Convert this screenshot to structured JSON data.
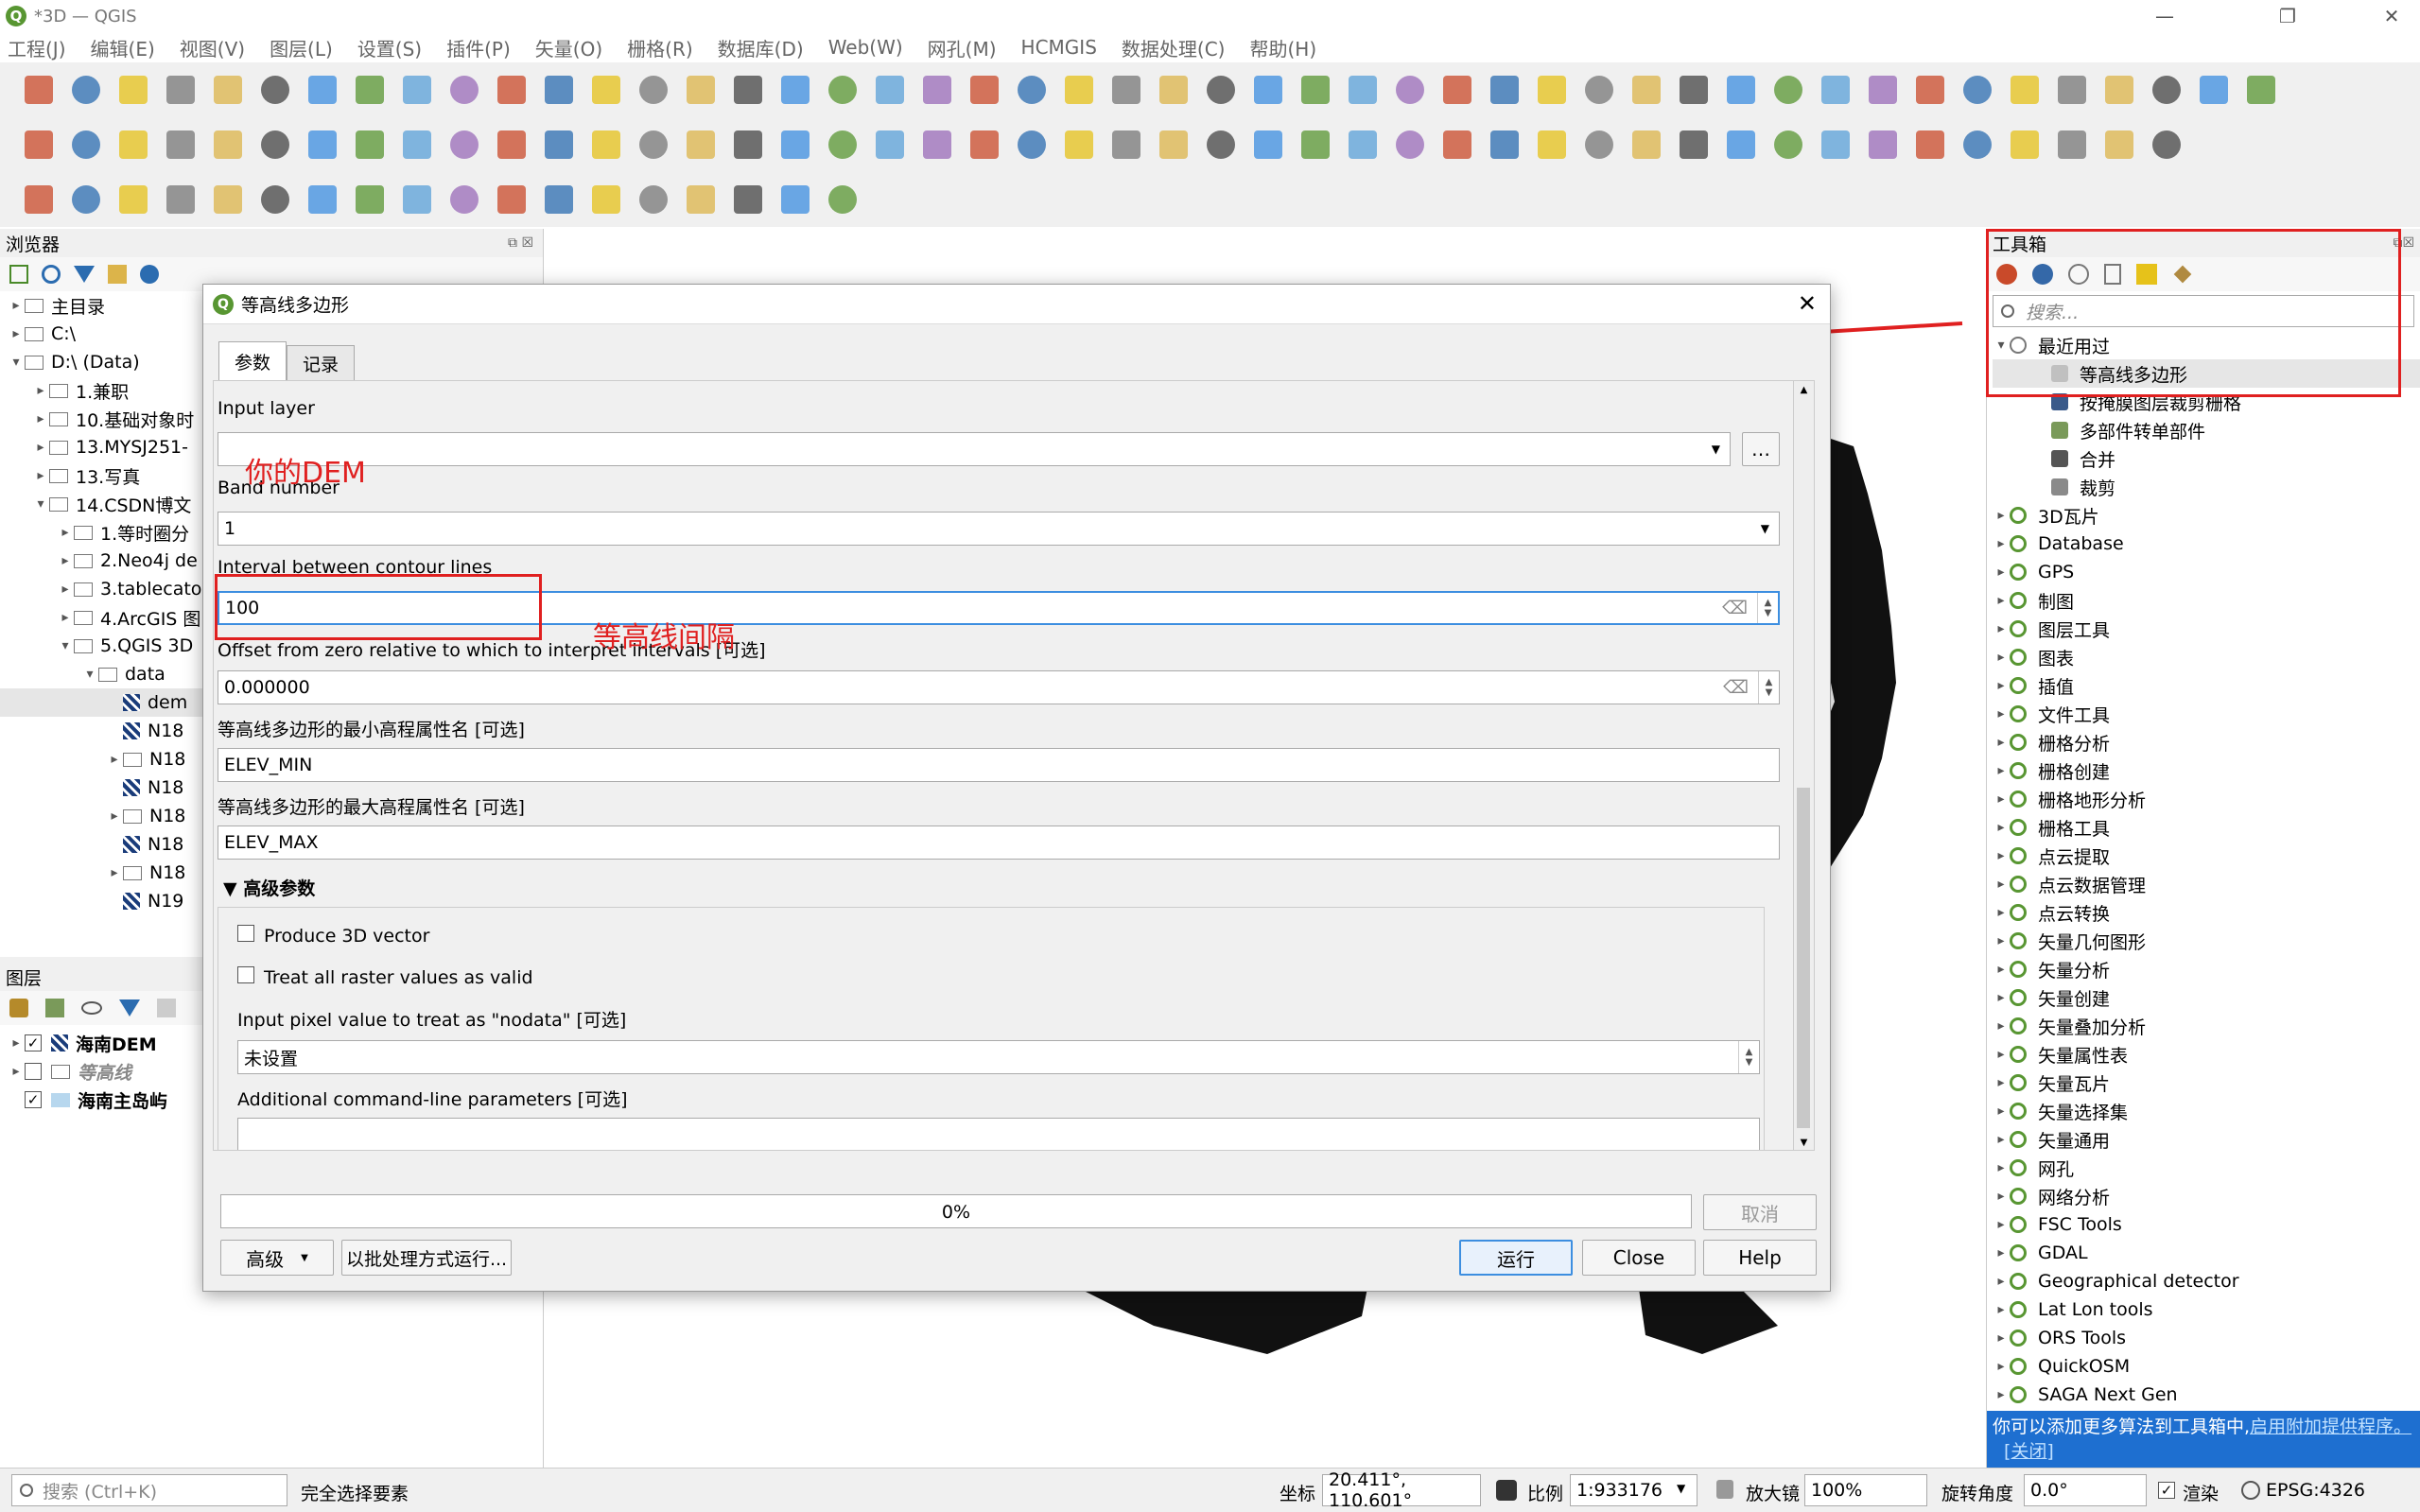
{
  "window": {
    "title": "*3D — QGIS"
  },
  "menu": [
    "工程(J)",
    "编辑(E)",
    "视图(V)",
    "图层(L)",
    "设置(S)",
    "插件(P)",
    "矢量(O)",
    "栅格(R)",
    "数据库(D)",
    "Web(W)",
    "网孔(M)",
    "HCMGIS",
    "数据处理(C)",
    "帮助(H)"
  ],
  "browser": {
    "title": "浏览器",
    "items": [
      {
        "label": "主目录",
        "depth": 0,
        "arrow": "▸",
        "icon": "folder"
      },
      {
        "label": "C:\\",
        "depth": 0,
        "arrow": "▸",
        "icon": "folder"
      },
      {
        "label": "D:\\ (Data)",
        "depth": 0,
        "arrow": "▾",
        "icon": "folder"
      },
      {
        "label": "1.兼职",
        "depth": 1,
        "arrow": "▸",
        "icon": "folder"
      },
      {
        "label": "10.基础对象时",
        "depth": 1,
        "arrow": "▸",
        "icon": "folder"
      },
      {
        "label": "13.MYSJ251-",
        "depth": 1,
        "arrow": "▸",
        "icon": "folder"
      },
      {
        "label": "13.写真",
        "depth": 1,
        "arrow": "▸",
        "icon": "folder"
      },
      {
        "label": "14.CSDN博文",
        "depth": 1,
        "arrow": "▾",
        "icon": "folder"
      },
      {
        "label": "1.等时圈分",
        "depth": 2,
        "arrow": "▸",
        "icon": "folder"
      },
      {
        "label": "2.Neo4j de",
        "depth": 2,
        "arrow": "▸",
        "icon": "folder"
      },
      {
        "label": "3.tablecato",
        "depth": 2,
        "arrow": "▸",
        "icon": "folder"
      },
      {
        "label": "4.ArcGIS 图",
        "depth": 2,
        "arrow": "▸",
        "icon": "folder"
      },
      {
        "label": "5.QGIS 3D",
        "depth": 2,
        "arrow": "▾",
        "icon": "folder"
      },
      {
        "label": "data",
        "depth": 3,
        "arrow": "▾",
        "icon": "folder"
      },
      {
        "label": "dem",
        "depth": 4,
        "arrow": "",
        "icon": "raster"
      },
      {
        "label": "N18",
        "depth": 4,
        "arrow": "",
        "icon": "raster"
      },
      {
        "label": "N18",
        "depth": 4,
        "arrow": "▸",
        "icon": "file"
      },
      {
        "label": "N18",
        "depth": 4,
        "arrow": "",
        "icon": "raster"
      },
      {
        "label": "N18",
        "depth": 4,
        "arrow": "▸",
        "icon": "file"
      },
      {
        "label": "N18",
        "depth": 4,
        "arrow": "",
        "icon": "raster"
      },
      {
        "label": "N18",
        "depth": 4,
        "arrow": "▸",
        "icon": "file"
      },
      {
        "label": "N19",
        "depth": 4,
        "arrow": "",
        "icon": "raster"
      }
    ]
  },
  "layers": {
    "title": "图层",
    "items": [
      {
        "label": "海南DEM",
        "checked": true
      },
      {
        "label": "等高线",
        "checked": false
      },
      {
        "label": "海南主岛屿",
        "checked": true
      }
    ]
  },
  "dialog": {
    "title": "等高线多边形",
    "tabs": [
      "参数",
      "记录"
    ],
    "input_layer_label": "Input layer",
    "band_label": "Band number",
    "band_value": "1",
    "interval_label": "Interval between contour lines",
    "interval_value": "100",
    "offset_label": "Offset from zero relative to which to interpret intervals [可选]",
    "offset_value": "0.000000",
    "min_attr_label": "等高线多边形的最小高程属性名 [可选]",
    "min_attr_value": "ELEV_MIN",
    "max_attr_label": "等高线多边形的最大高程属性名 [可选]",
    "max_attr_value": "ELEV_MAX",
    "advanced_label": "高级参数",
    "produce3d_label": "Produce 3D vector",
    "treat_all_label": "Treat all raster values as valid",
    "nodata_label": "Input pixel value to treat as \"nodata\" [可选]",
    "nodata_value": "未设置",
    "extra_label": "Additional command-line parameters [可选]",
    "progress_text": "0%",
    "progress": 0,
    "cancel": "取消",
    "advanced_btn": "高级",
    "batch_btn": "以批处理方式运行...",
    "run_btn": "运行",
    "close_btn": "Close",
    "help_btn": "Help"
  },
  "annotations": {
    "dem_note": "你的DEM",
    "interval_note": "等高线间隔"
  },
  "toolbox": {
    "title": "工具箱",
    "search_placeholder": "搜索...",
    "recent_label": "最近用过",
    "recent_items": [
      "等高线多边形",
      "按掩膜图层裁剪栅格",
      "多部件转单部件",
      "合并",
      "裁剪"
    ],
    "groups": [
      "3D瓦片",
      "Database",
      "GPS",
      "制图",
      "图层工具",
      "图表",
      "插值",
      "文件工具",
      "栅格分析",
      "栅格创建",
      "栅格地形分析",
      "栅格工具",
      "点云提取",
      "点云数据管理",
      "点云转换",
      "矢量几何图形",
      "矢量分析",
      "矢量创建",
      "矢量叠加分析",
      "矢量属性表",
      "矢量瓦片",
      "矢量选择集",
      "矢量通用",
      "网孔",
      "网络分析",
      "FSC Tools",
      "GDAL",
      "Geographical detector",
      "Lat Lon tools",
      "ORS Tools",
      "QuickOSM",
      "SAGA Next Gen"
    ],
    "notice_text": "你可以添加更多算法到工具箱中,",
    "notice_link": "启用附加提供程序。",
    "notice_close": "[关闭]"
  },
  "statusbar": {
    "search_placeholder": "搜索 (Ctrl+K)",
    "message": "完全选择要素",
    "coord_label": "坐标",
    "coord_value": "20.411°, 110.601°",
    "scale_label": "比例",
    "scale_value": "1:933176",
    "magnifier_label": "放大镜",
    "magnifier_value": "100%",
    "rotation_label": "旋转角度",
    "rotation_value": "0.0°",
    "render_label": "渲染",
    "crs": "EPSG:4326"
  },
  "colors": {
    "annotation_red": "#e02020",
    "qgis_green": "#589632",
    "link_blue": "#0b57d0"
  }
}
